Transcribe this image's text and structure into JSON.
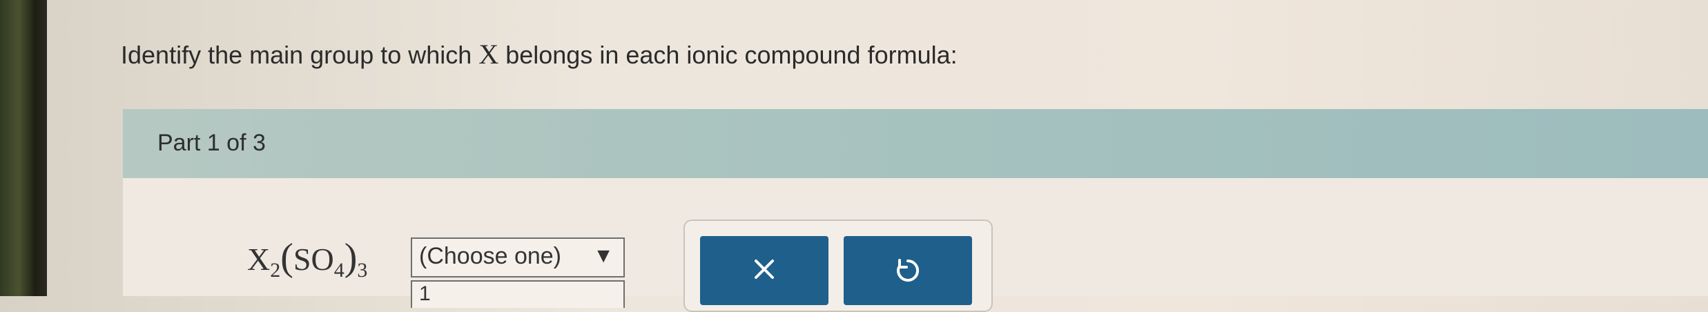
{
  "question": {
    "prefix": "Identify the main group to which",
    "variable": "X",
    "suffix": "belongs in each ionic compound formula:"
  },
  "part": {
    "label": "Part 1 of 3"
  },
  "formula": {
    "element": "X",
    "element_subscript": "2",
    "polyatomic": "SO",
    "polyatomic_subscript": "4",
    "outer_subscript": "3"
  },
  "select": {
    "value": "(Choose one)",
    "arrow": "▼",
    "next_option_partial": "1"
  },
  "actions": {
    "clear_icon": "close-icon",
    "undo_icon": "undo-icon"
  },
  "colors": {
    "header_bg": "#a6c2bf",
    "button_bg": "#1f5f8b"
  }
}
